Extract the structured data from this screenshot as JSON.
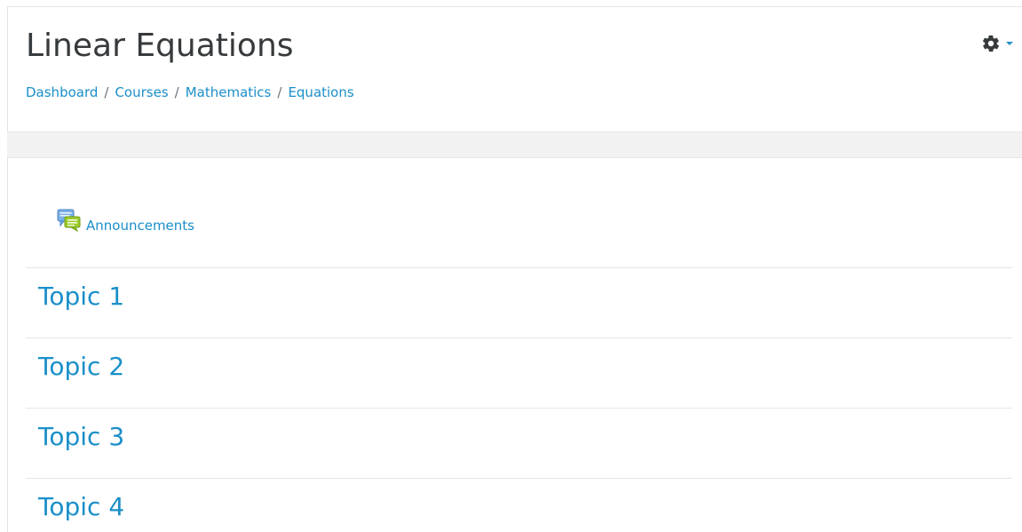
{
  "page": {
    "title": "Linear Equations"
  },
  "breadcrumb": {
    "items": [
      "Dashboard",
      "Courses",
      "Mathematics",
      "Equations"
    ],
    "separator": "/"
  },
  "settings": {
    "icon": "gear-icon",
    "menu_indicator": "caret-down-icon"
  },
  "activity": {
    "label": "Announcements",
    "icon": "forum-icon"
  },
  "sections": [
    {
      "title": "Topic 1"
    },
    {
      "title": "Topic 2"
    },
    {
      "title": "Topic 3"
    },
    {
      "title": "Topic 4"
    }
  ],
  "colors": {
    "link": "#1a8fc9",
    "title_text": "#373a3c",
    "band": "#f2f2f2",
    "gear": "#373a3c"
  }
}
